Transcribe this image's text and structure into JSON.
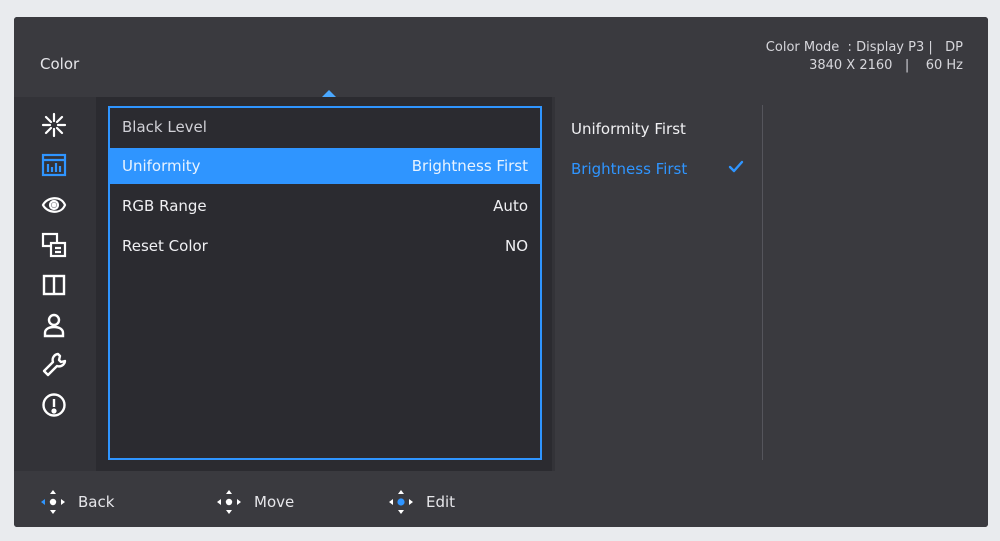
{
  "header": {
    "title": "Color",
    "info_line1": "Color Mode  : Display P3 |   DP",
    "info_line2": "3840 X 2160   |    60 Hz"
  },
  "sidebar": {
    "icons": [
      "brightness-icon",
      "color-bars-icon",
      "eye-target-icon",
      "input-switch-icon",
      "split-screen-icon",
      "person-icon",
      "wrench-icon",
      "info-icon"
    ]
  },
  "menu": {
    "items": [
      {
        "label": "Black Level",
        "value": ""
      },
      {
        "label": "Uniformity",
        "value": "Brightness First"
      },
      {
        "label": "RGB Range",
        "value": "Auto"
      },
      {
        "label": "Reset Color",
        "value": "NO"
      }
    ]
  },
  "options": {
    "items": [
      {
        "label": "Uniformity First"
      },
      {
        "label": "Brightness First"
      }
    ]
  },
  "footer": {
    "back": "Back",
    "move": "Move",
    "edit": "Edit"
  },
  "colors": {
    "accent": "#2f95ff",
    "panel": "#2b2b30",
    "background": "#333338"
  }
}
